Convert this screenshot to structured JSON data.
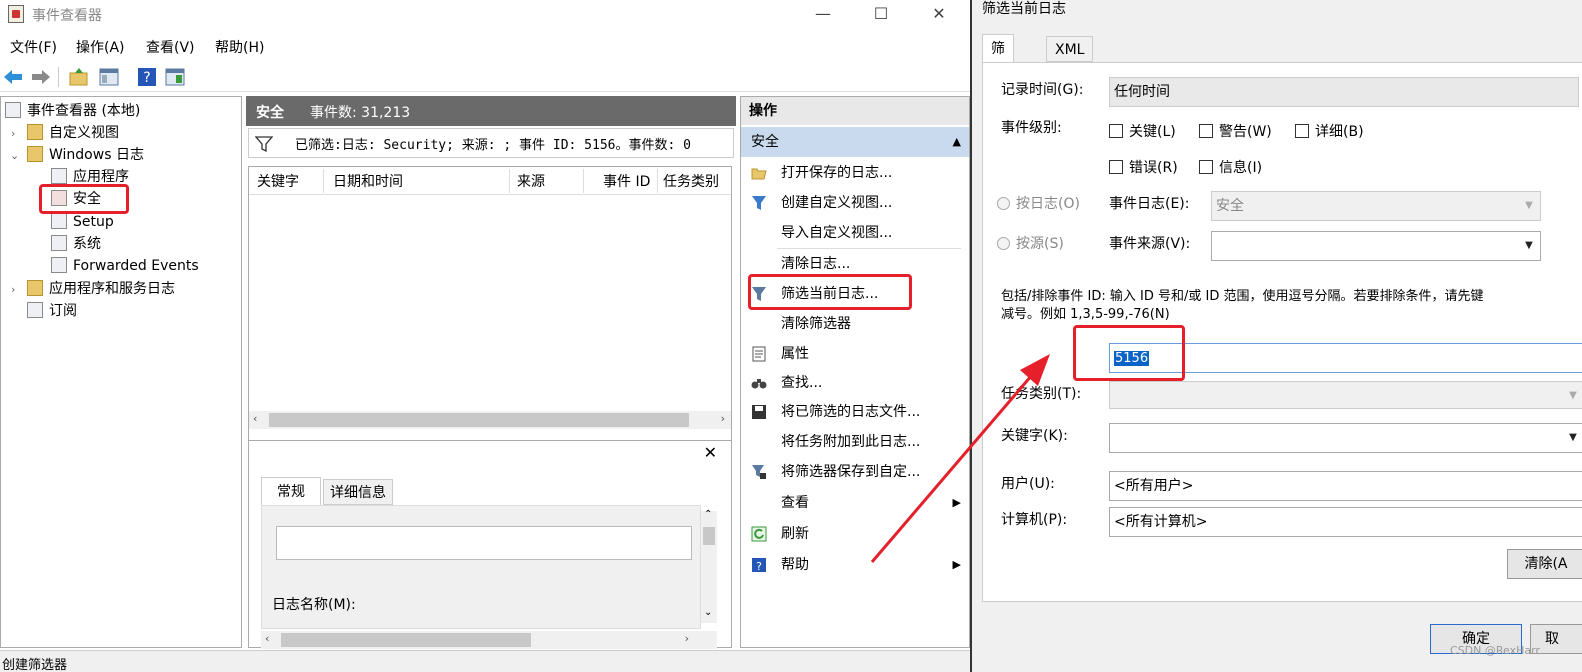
{
  "window": {
    "title": "事件查看器",
    "minimize": "—",
    "maximize": "☐",
    "close": "✕"
  },
  "menu": [
    "文件(F)",
    "操作(A)",
    "查看(V)",
    "帮助(H)"
  ],
  "toolbar": {
    "back_icon": "arrow-left-icon",
    "forward_icon": "arrow-right-icon",
    "up_icon": "folder-up-icon",
    "console_icon": "console-tree-icon",
    "help_icon": "help-icon",
    "action_pane_icon": "action-pane-icon"
  },
  "tree": {
    "root": "事件查看器 (本地)",
    "custom_views": "自定义视图",
    "windows_logs": "Windows 日志",
    "application": "应用程序",
    "security": "安全",
    "setup": "Setup",
    "system": "系统",
    "forwarded": "Forwarded Events",
    "app_service_logs": "应用程序和服务日志",
    "subscriptions": "订阅"
  },
  "middle": {
    "header_title": "安全",
    "header_count": "事件数: 31,213",
    "filter_text": "已筛选:日志: Security; 来源: ; 事件 ID: 5156。事件数: 0",
    "columns": [
      "关键字",
      "日期和时间",
      "来源",
      "事件 ID",
      "任务类别"
    ],
    "detail_tabs": [
      "常规",
      "详细信息"
    ],
    "detail_close": "✕",
    "log_name_label": "日志名称(M):"
  },
  "actions": {
    "header": "操作",
    "section": "安全",
    "items": [
      "打开保存的日志...",
      "创建自定义视图...",
      "导入自定义视图...",
      "清除日志...",
      "筛选当前日志...",
      "清除筛选器",
      "属性",
      "查找...",
      "将已筛选的日志文件...",
      "将任务附加到此日志...",
      "将筛选器保存到自定...",
      "查看",
      "刷新",
      "帮助"
    ]
  },
  "dialog": {
    "title": "筛选当前日志",
    "tabs": [
      "筛选器",
      "XML"
    ],
    "logged_label": "记录时间(G):",
    "logged_value": "任何时间",
    "level_label": "事件级别:",
    "levels": [
      "关键(L)",
      "警告(W)",
      "详细(B)",
      "错误(R)",
      "信息(I)"
    ],
    "by_log": "按日志(O)",
    "by_source": "按源(S)",
    "event_logs_label": "事件日志(E):",
    "event_logs_value": "安全",
    "event_sources_label": "事件来源(V):",
    "instructions_line1": "包括/排除事件 ID: 输入 ID 号和/或 ID 范围，使用逗号分隔。若要排除条件，请先键",
    "instructions_line2": "减号。例如 1,3,5-99,-76(N)",
    "event_id_value": "5156",
    "task_category_label": "任务类别(T):",
    "keywords_label": "关键字(K):",
    "user_label": "用户(U):",
    "user_value": "<所有用户>",
    "computer_label": "计算机(P):",
    "computer_value": "<所有计算机>",
    "clear_button": "清除(A",
    "ok_button": "确定",
    "cancel_button": "取"
  },
  "statusbar": {
    "text": "创建筛选器"
  },
  "watermark": "CSDN @RexHarr",
  "colors": {
    "highlight_red": "#e5202a",
    "selection_blue": "#0a64c8",
    "action_header_blue": "#c9d9ee"
  }
}
